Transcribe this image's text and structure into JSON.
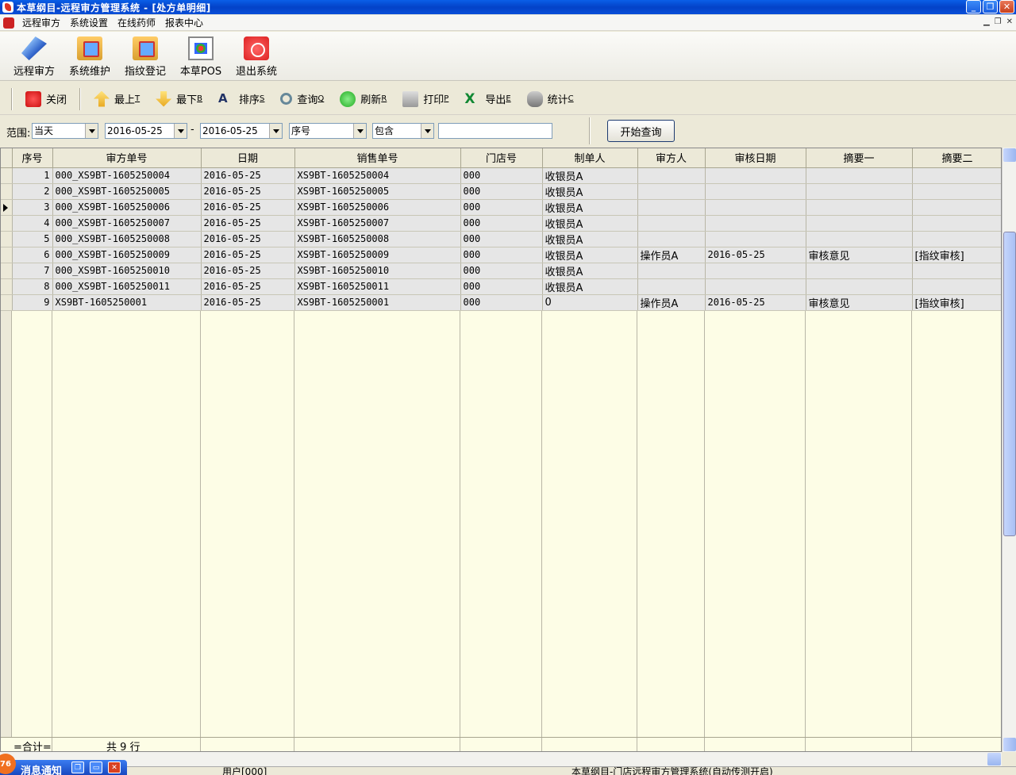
{
  "window": {
    "title": "本草纲目-远程审方管理系统 - [处方单明细]"
  },
  "menu": {
    "items": [
      "远程审方",
      "系统设置",
      "在线药师",
      "报表中心"
    ]
  },
  "big_toolbar": [
    {
      "label": "远程审方",
      "icon": "pen-icon"
    },
    {
      "label": "系统维护",
      "icon": "folder-tools-icon"
    },
    {
      "label": "指纹登记",
      "icon": "folder-fingerprint-icon"
    },
    {
      "label": "本草POS",
      "icon": "pos-icon"
    },
    {
      "label": "退出系统",
      "icon": "power-icon"
    }
  ],
  "small_toolbar": [
    {
      "label": "关闭",
      "key": ""
    },
    {
      "label": "最上",
      "key": "T"
    },
    {
      "label": "最下",
      "key": "B"
    },
    {
      "label": "排序",
      "key": "S"
    },
    {
      "label": "查询",
      "key": "Q"
    },
    {
      "label": "刷新",
      "key": "R"
    },
    {
      "label": "打印",
      "key": "P"
    },
    {
      "label": "导出",
      "key": "E"
    },
    {
      "label": "统计",
      "key": "C"
    }
  ],
  "filter": {
    "range_label": "范围:",
    "range_value": "当天",
    "date_from": "2016-05-25",
    "date_sep": "-",
    "date_to": "2016-05-25",
    "field": "序号",
    "operator": "包含",
    "value": "",
    "query_button": "开始查询"
  },
  "table": {
    "columns": [
      "序号",
      "审方单号",
      "日期",
      "销售单号",
      "门店号",
      "制单人",
      "审方人",
      "审核日期",
      "摘要一",
      "摘要二"
    ],
    "rows": [
      [
        "1",
        "000_XS9BT-1605250004",
        "2016-05-25",
        "XS9BT-1605250004",
        "000",
        "收银员A",
        "",
        "",
        "",
        ""
      ],
      [
        "2",
        "000_XS9BT-1605250005",
        "2016-05-25",
        "XS9BT-1605250005",
        "000",
        "收银员A",
        "",
        "",
        "",
        ""
      ],
      [
        "3",
        "000_XS9BT-1605250006",
        "2016-05-25",
        "XS9BT-1605250006",
        "000",
        "收银员A",
        "",
        "",
        "",
        ""
      ],
      [
        "4",
        "000_XS9BT-1605250007",
        "2016-05-25",
        "XS9BT-1605250007",
        "000",
        "收银员A",
        "",
        "",
        "",
        ""
      ],
      [
        "5",
        "000_XS9BT-1605250008",
        "2016-05-25",
        "XS9BT-1605250008",
        "000",
        "收银员A",
        "",
        "",
        "",
        ""
      ],
      [
        "6",
        "000_XS9BT-1605250009",
        "2016-05-25",
        "XS9BT-1605250009",
        "000",
        "收银员A",
        "操作员A",
        "2016-05-25",
        "审核意见",
        "[指纹审核]"
      ],
      [
        "7",
        "000_XS9BT-1605250010",
        "2016-05-25",
        "XS9BT-1605250010",
        "000",
        "收银员A",
        "",
        "",
        "",
        ""
      ],
      [
        "8",
        "000_XS9BT-1605250011",
        "2016-05-25",
        "XS9BT-1605250011",
        "000",
        "收银员A",
        "",
        "",
        "",
        ""
      ],
      [
        "9",
        "XS9BT-1605250001",
        "2016-05-25",
        "XS9BT-1605250001",
        "000",
        "0",
        "操作员A",
        "2016-05-25",
        "审核意见",
        "[指纹审核]"
      ]
    ],
    "current_row_index": 2,
    "footer_label": "=合计=",
    "footer_count": "共 9 行"
  },
  "status": {
    "left": "用户[000]",
    "right": "本草纲目-门店远程审方管理系统(自动传测开启)"
  },
  "notification": {
    "title": "消息通知",
    "badge": "76"
  }
}
